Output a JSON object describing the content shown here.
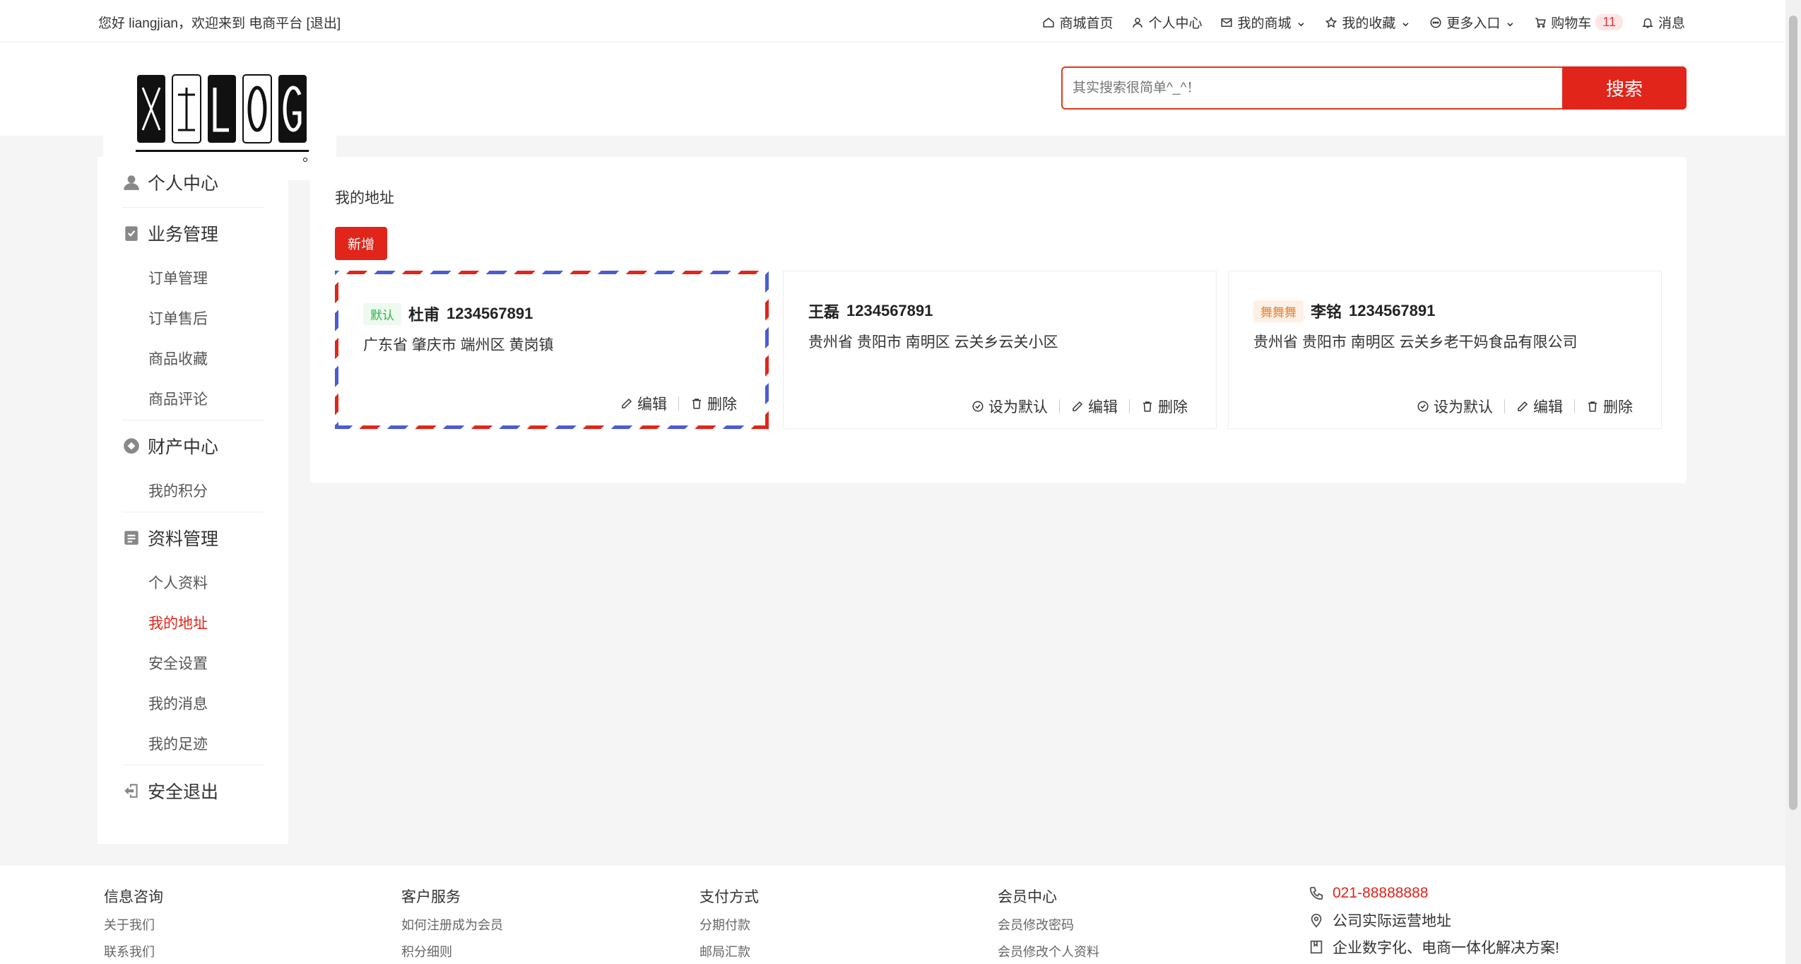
{
  "topbar": {
    "greeting": "您好 liangjian，欢迎来到 电商平台 [退出]",
    "nav": [
      {
        "label": "商城首页",
        "icon": "home-icon"
      },
      {
        "label": "个人中心",
        "icon": "user-icon"
      },
      {
        "label": "我的商城",
        "icon": "mail-icon"
      },
      {
        "label": "我的收藏",
        "icon": "star-icon"
      },
      {
        "label": "更多入口",
        "icon": "more-icon"
      },
      {
        "label": "购物车",
        "icon": "cart-icon",
        "badge": "11"
      },
      {
        "label": "消息",
        "icon": "bell-icon"
      }
    ]
  },
  "search": {
    "placeholder": "其实搜索很简单^_^！",
    "button": "搜索"
  },
  "sidebar": {
    "groups": [
      {
        "title": "个人中心",
        "icon": "user-icon",
        "items": []
      },
      {
        "title": "业务管理",
        "icon": "clipboard-icon",
        "items": [
          "订单管理",
          "订单售后",
          "商品收藏",
          "商品评论"
        ]
      },
      {
        "title": "财产中心",
        "icon": "diamond-icon",
        "items": [
          "我的积分"
        ]
      },
      {
        "title": "资料管理",
        "icon": "profile-icon",
        "items": [
          "个人资料",
          "我的地址",
          "安全设置",
          "我的消息",
          "我的足迹"
        ]
      },
      {
        "title": "安全退出",
        "icon": "logout-icon",
        "items": []
      }
    ],
    "active_item": "我的地址"
  },
  "main": {
    "title": "我的地址",
    "add_button": "新增",
    "addresses": [
      {
        "tag": "默认",
        "tag_color": "#2fb34c",
        "name": "杜甫",
        "phone": "1234567891",
        "address": "广东省 肇庆市 端州区 黄岗镇",
        "is_default": true,
        "ops": [
          "编辑",
          "删除"
        ]
      },
      {
        "tag": "",
        "name": "王磊",
        "phone": "1234567891",
        "address": "贵州省 贵阳市 南明区 云关乡云关小区",
        "is_default": false,
        "ops": [
          "设为默认",
          "编辑",
          "删除"
        ]
      },
      {
        "tag": "舞舞舞",
        "tag_color": "#f0812b",
        "name": "李铭",
        "phone": "1234567891",
        "address": "贵州省 贵阳市 南明区 云关乡老干妈食品有限公司",
        "is_default": false,
        "ops": [
          "设为默认",
          "编辑",
          "删除"
        ]
      }
    ]
  },
  "footer": {
    "columns": [
      {
        "title": "信息咨询",
        "links": [
          "关于我们",
          "联系我们"
        ]
      },
      {
        "title": "客户服务",
        "links": [
          "如何注册成为会员",
          "积分细则"
        ]
      },
      {
        "title": "支付方式",
        "links": [
          "分期付款",
          "邮局汇款"
        ]
      },
      {
        "title": "会员中心",
        "links": [
          "会员修改密码",
          "会员修改个人资料"
        ]
      }
    ],
    "contact": {
      "phone": "021-88888888",
      "address": "公司实际运营地址",
      "slogan": "企业数字化、电商一体化解决方案!"
    }
  },
  "colors": {
    "accent": "#e1251b",
    "default_tag": "#2fb34c",
    "custom_tag": "#f0812b"
  }
}
